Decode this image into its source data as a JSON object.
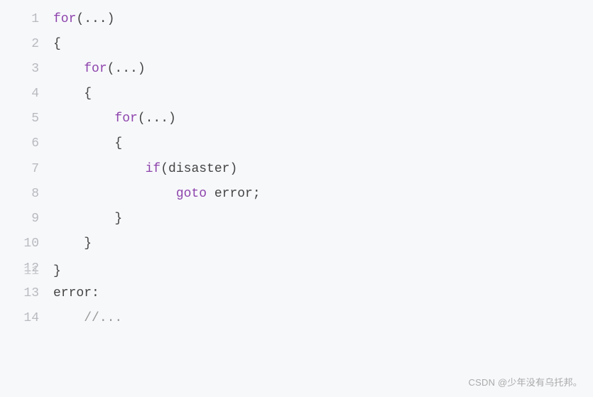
{
  "code": {
    "lines": [
      {
        "num": "1",
        "indent": "",
        "tokens": [
          {
            "t": "for",
            "c": "keyword"
          },
          {
            "t": "(...)",
            "c": "punct"
          }
        ]
      },
      {
        "num": "2",
        "indent": "",
        "tokens": [
          {
            "t": "{",
            "c": "punct"
          }
        ]
      },
      {
        "num": "3",
        "indent": "    ",
        "tokens": [
          {
            "t": "for",
            "c": "keyword"
          },
          {
            "t": "(...)",
            "c": "punct"
          }
        ]
      },
      {
        "num": "4",
        "indent": "    ",
        "tokens": [
          {
            "t": "{",
            "c": "punct"
          }
        ]
      },
      {
        "num": "5",
        "indent": "        ",
        "tokens": [
          {
            "t": "for",
            "c": "keyword"
          },
          {
            "t": "(...)",
            "c": "punct"
          }
        ]
      },
      {
        "num": "6",
        "indent": "        ",
        "tokens": [
          {
            "t": "{",
            "c": "punct"
          }
        ]
      },
      {
        "num": "7",
        "indent": "            ",
        "tokens": [
          {
            "t": "if",
            "c": "keyword"
          },
          {
            "t": "(disaster)",
            "c": "text"
          }
        ]
      },
      {
        "num": "8",
        "indent": "                ",
        "tokens": [
          {
            "t": "goto",
            "c": "keyword"
          },
          {
            "t": " error;",
            "c": "text"
          }
        ]
      },
      {
        "num": "9",
        "indent": "        ",
        "tokens": [
          {
            "t": "}",
            "c": "punct"
          }
        ]
      },
      {
        "num": "10",
        "indent": "    ",
        "tokens": [
          {
            "t": "}",
            "c": "punct"
          }
        ]
      },
      {
        "num": "12",
        "indent": "",
        "tokens": []
      },
      {
        "num": "13",
        "indent": "",
        "tokens": [
          {
            "t": "error:",
            "c": "text"
          }
        ]
      },
      {
        "num": "14",
        "indent": "    ",
        "tokens": [
          {
            "t": "//...",
            "c": "comment"
          }
        ]
      }
    ],
    "overlap_line": {
      "num": "11",
      "indent": "",
      "tokens": [
        {
          "t": "}",
          "c": "punct"
        }
      ]
    }
  },
  "watermark": "CSDN @少年没有乌托邦。"
}
